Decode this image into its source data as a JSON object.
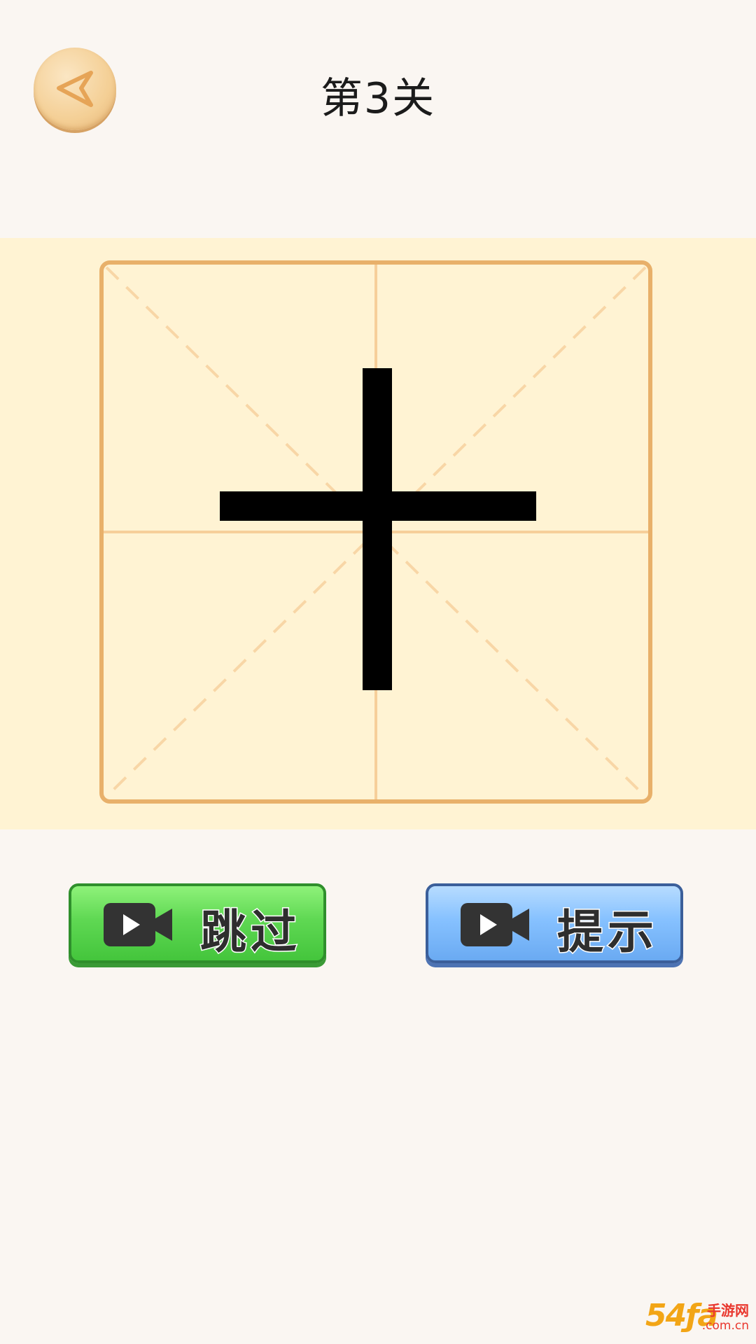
{
  "header": {
    "title": "第3关",
    "back_icon": "back-arrow-icon"
  },
  "puzzle": {
    "character": "十",
    "grid_type": "米字格",
    "colors": {
      "grid_border": "#e8b06a",
      "grid_lines": "#f6cf9a",
      "stroke": "#000000",
      "background": "#fff3d3"
    }
  },
  "actions": {
    "skip_label": "跳过",
    "skip_icon": "video-camera-icon",
    "hint_label": "提示",
    "hint_icon": "video-camera-icon"
  },
  "watermark": {
    "big": "54ƒa",
    "top": "手游网",
    "bottom": ".com.cn"
  }
}
